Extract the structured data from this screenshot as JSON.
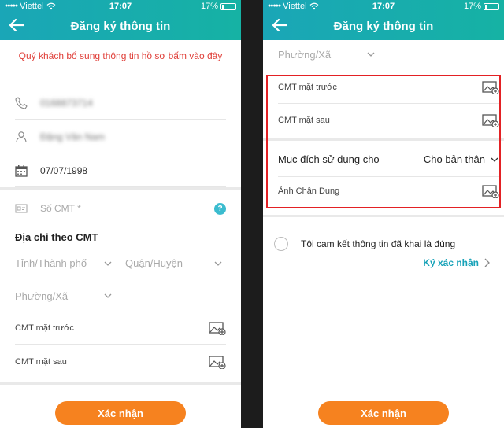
{
  "status_bar": {
    "carrier": "Viettel",
    "time": "17:07",
    "battery": "17%"
  },
  "header": {
    "title": "Đăng ký thông tin"
  },
  "left": {
    "notice": "Quý khách bổ sung thông tin hồ sơ bấm vào đây",
    "phone_value": "0168873714",
    "name_value": "Đặng Văn Nam",
    "dob_value": "07/07/1998",
    "id_placeholder": "Số CMT *",
    "address_title": "Địa chỉ theo CMT",
    "province_placeholder": "Tỉnh/Thành phố",
    "district_placeholder": "Quận/Huyện",
    "ward_placeholder": "Phường/Xã",
    "front_id_label": "CMT mặt trước",
    "back_id_label": "CMT mặt sau"
  },
  "right": {
    "ward_placeholder": "Phường/Xã",
    "front_id_label": "CMT mặt trước",
    "back_id_label": "CMT mặt sau",
    "purpose_label": "Mục đích sử dụng cho",
    "purpose_value": "Cho bản thân",
    "portrait_label": "Ảnh Chân Dung",
    "commit_text": "Tôi cam kết thông tin đã khai là đúng",
    "sign_link": "Ký xác nhận"
  },
  "confirm_button": "Xác nhận",
  "icons": {
    "phone": "phone-icon",
    "user": "user-icon",
    "calendar": "calendar-icon",
    "id_card": "id-card-icon",
    "help": "?",
    "image_add": "image-add-icon"
  },
  "colors": {
    "header": "#1aa6b7",
    "accent": "#f6821f",
    "notice": "#e0403a",
    "link": "#17a2b8",
    "highlight": "#e32124"
  }
}
